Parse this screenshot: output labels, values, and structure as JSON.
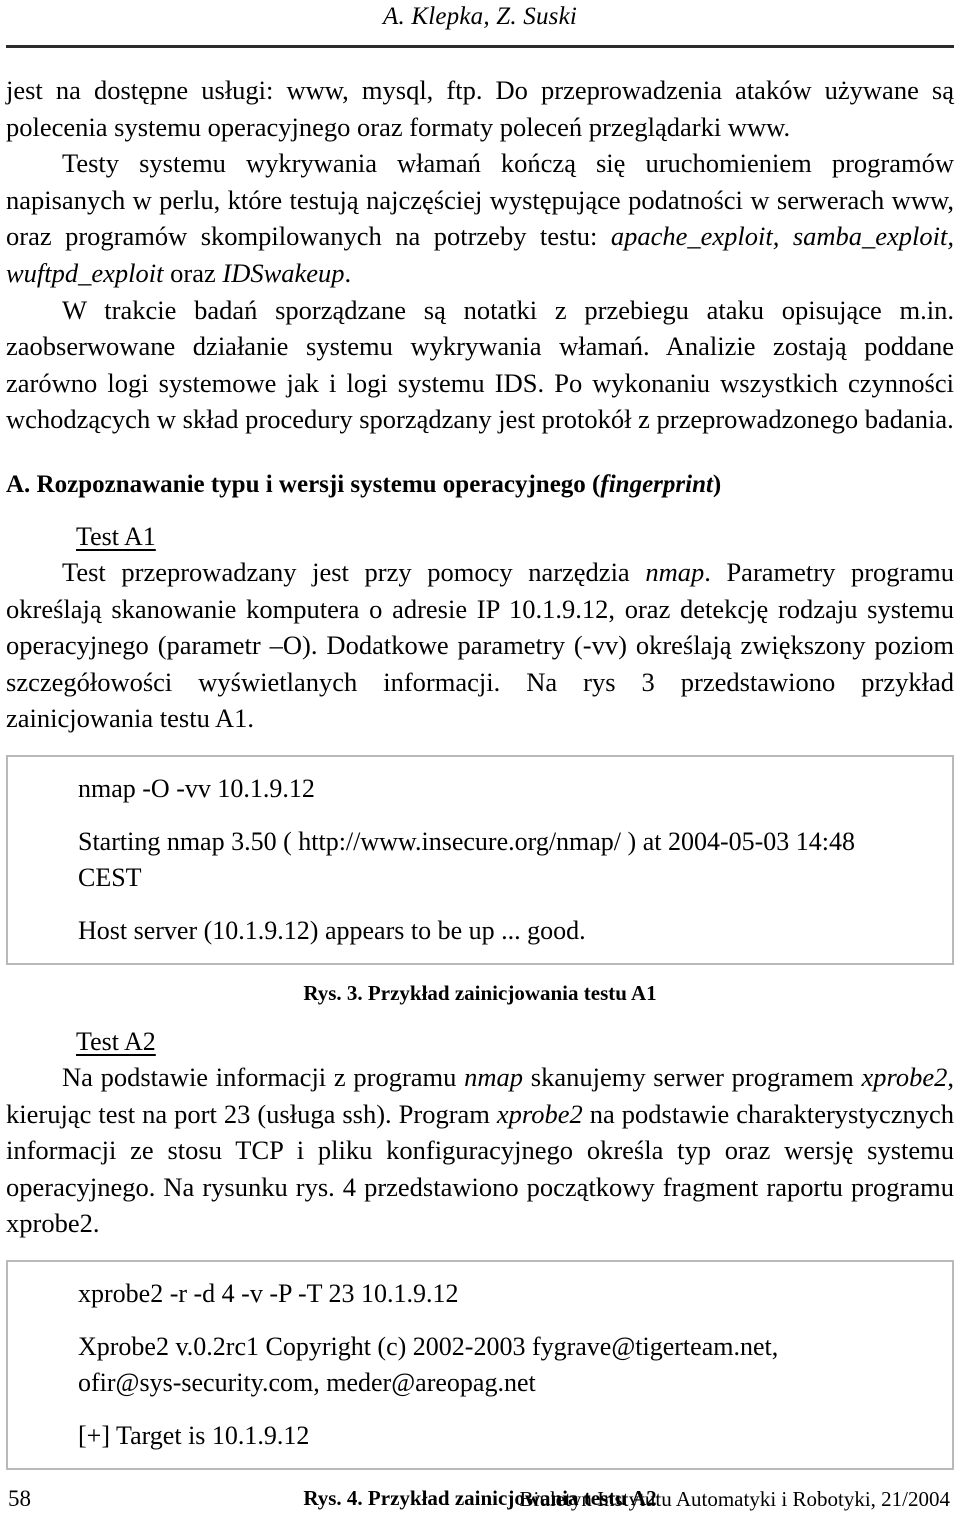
{
  "running_head": "A. Klepka, Z. Suski",
  "paragraphs": {
    "p1_line": "jest na dostępne usługi: www, mysql, ftp. Do przeprowadzenia ataków używane są polecenia systemu operacyjnego oraz formaty poleceń przeglądarki www.",
    "p2_intro": "Testy systemu wykrywania włamań kończą się uruchomieniem programów napisanych w perlu, które testują najczęściej występujące podatności w serwerach www, oraz programów skompilowanych na potrzeby testu:",
    "p2_tools_italic": "apache_exploit, samba_exploit, wuftpd_exploit",
    "p2_tools_tail": " oraz ",
    "p2_tools_italic2": "IDSwakeup",
    "p2_tools_end": ".",
    "p3": "W trakcie badań sporządzane są notatki z przebiegu ataku opisujące m.in. zaobserwowane działanie systemu wykrywania włamań. Analizie zostają poddane zarówno logi systemowe jak i logi systemu IDS. Po wykonaniu wszystkich czynności wchodzących w skład procedury sporządzany jest protokół z przeprowadzonego badania.",
    "p4_a": "Test przeprowadzany jest przy pomocy narzędzia ",
    "p4_italic": "nmap",
    "p4_b": ". Parametry programu określają skanowanie komputera o adresie IP 10.1.9.12, oraz detekcję rodzaju systemu operacyjnego (parametr –O). Dodatkowe parametry (-vv) określają zwiększony poziom szczegółowości wyświetlanych informacji. Na rys 3 przedstawiono przykład zainicjowania testu A1.",
    "p5_a": "Na podstawie informacji z programu ",
    "p5_italic1": "nmap",
    "p5_b": " skanujemy serwer programem ",
    "p5_italic2": "xprobe2",
    "p5_c": ", kierując test na port 23 (usługa ssh). Program ",
    "p5_italic3": "xprobe2",
    "p5_d": " na podstawie charakterystycznych informacji ze stosu TCP i pliku konfiguracyjnego określa typ oraz wersję systemu operacyjnego. Na rysunku rys. 4 przedstawiono początkowy fragment raportu programu xprobe2."
  },
  "section_a": {
    "prefix": "A. Rozpoznawanie typu i wersji systemu operacyjnego (",
    "italic": "fingerprint",
    "suffix": ")"
  },
  "sub_headings": {
    "test_a1": "Test A1",
    "test_a2": "Test A2"
  },
  "listing_a1": {
    "lines": [
      "nmap -O -vv 10.1.9.12",
      "Starting nmap 3.50 ( http://www.insecure.org/nmap/ ) at 2004-05-03 14:48",
      "CEST",
      "Host server (10.1.9.12) appears to be up ... good."
    ]
  },
  "listing_a2": {
    "lines": [
      "xprobe2 -r -d 4 -v -P -T 23 10.1.9.12",
      "Xprobe2  v.0.2rc1  Copyright  (c)  2002-2003  fygrave@tigerteam.net,",
      "ofir@sys-security.com, meder@areopag.net",
      "[+] Target is 10.1.9.12"
    ]
  },
  "captions": {
    "fig3": "Rys. 3.  Przykład zainicjowania testu A1",
    "fig4": "Rys. 4.  Przykład zainicjowania testu A2"
  },
  "footer": {
    "page_number": "58",
    "journal": "Biuletyn Instytutu Automatyki i Robotyki, 21/2004"
  },
  "colors": {
    "text": "#000000",
    "rule": "#2b2b2b",
    "box_border": "#b9b9b9",
    "background": "#ffffff"
  }
}
